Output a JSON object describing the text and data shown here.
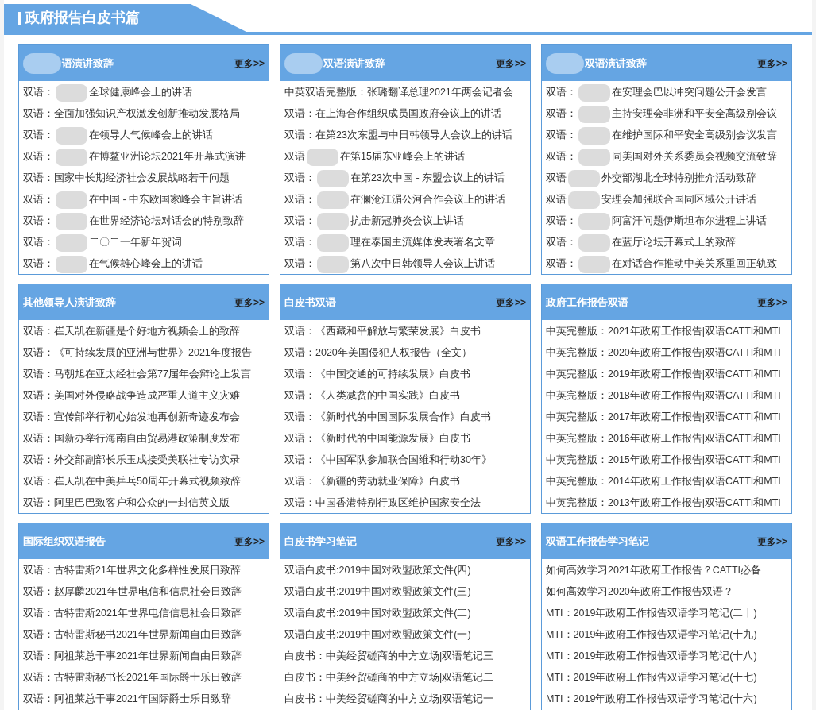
{
  "section_title": "政府报告白皮书篇",
  "panels": [
    {
      "title": "语演讲致辞",
      "title_blurred": true,
      "more": "更多>>",
      "items": [
        {
          "lead": "双语：",
          "tail": "全球健康峰会上的讲话",
          "blurred": true
        },
        {
          "lead": "双语：全面加强知识产权激发创新推动发展格局"
        },
        {
          "lead": "双语：",
          "tail": "在领导人气候峰会上的讲话",
          "blurred": true
        },
        {
          "lead": "双语：",
          "tail": "在博鳌亚洲论坛2021年开幕式演讲",
          "blurred": true
        },
        {
          "lead": "双语：国家中长期经济社会发展战略若干问题"
        },
        {
          "lead": "双语：",
          "tail": "在中国 - 中东欧国家峰会主旨讲话",
          "blurred": true
        },
        {
          "lead": "双语：",
          "tail": "在世界经济论坛对话会的特别致辞",
          "blurred": true
        },
        {
          "lead": "双语：",
          "tail": "二〇二一年新年贺词",
          "blurred": true
        },
        {
          "lead": "双语：",
          "tail": "在气候雄心峰会上的讲话",
          "blurred": true
        }
      ]
    },
    {
      "title": "双语演讲致辞",
      "title_blurred": true,
      "more": "更多>>",
      "items": [
        {
          "lead": "中英双语完整版：张璐翻译总理2021年两会记者会"
        },
        {
          "lead": "双语：在上海合作组织成员国政府会议上的讲话"
        },
        {
          "lead": "双语：在第23次东盟与中日韩领导人会议上的讲话"
        },
        {
          "lead": "双语",
          "tail": "在第15届东亚峰会上的讲话",
          "blurred": true
        },
        {
          "lead": "双语：",
          "tail": "在第23次中国 - 东盟会议上的讲话",
          "blurred": true
        },
        {
          "lead": "双语：",
          "tail": "在澜沧江湄公河合作会议上的讲话",
          "blurred": true
        },
        {
          "lead": "双语：",
          "tail": "抗击新冠肺炎会议上讲话",
          "blurred": true
        },
        {
          "lead": "双语：",
          "tail": "理在泰国主流媒体发表署名文章",
          "blurred": true
        },
        {
          "lead": "双语：",
          "tail": "第八次中日韩领导人会议上讲话",
          "blurred": true
        }
      ]
    },
    {
      "title": "双语演讲致辞",
      "title_blurred": true,
      "more": "更多>>",
      "items": [
        {
          "lead": "双语：",
          "tail": "在安理会巴以冲突问题公开会发言",
          "blurred": true
        },
        {
          "lead": "双语：",
          "tail": "主持安理会非洲和平安全高级别会议",
          "blurred": true
        },
        {
          "lead": "双语：",
          "tail": "在维护国际和平安全高级别会议发言",
          "blurred": true
        },
        {
          "lead": "双语：",
          "tail": "同美国对外关系委员会视频交流致辞",
          "blurred": true
        },
        {
          "lead": "双语",
          "tail": "外交部湖北全球特别推介活动致辞",
          "blurred": true
        },
        {
          "lead": "双语",
          "tail": "安理会加强联合国同区域公开讲话",
          "blurred": true
        },
        {
          "lead": "双语：",
          "tail": "阿富汗问题伊斯坦布尔进程上讲话",
          "blurred": true
        },
        {
          "lead": "双语：",
          "tail": "在蓝厅论坛开幕式上的致辞",
          "blurred": true
        },
        {
          "lead": "双语：",
          "tail": "在对话合作推动中美关系重回正轨致",
          "blurred": true
        }
      ]
    },
    {
      "title": "其他领导人演讲致辞",
      "more": "更多>>",
      "items": [
        {
          "lead": "双语：崔天凯在新疆是个好地方视频会上的致辞"
        },
        {
          "lead": "双语：《可持续发展的亚洲与世界》2021年度报告"
        },
        {
          "lead": "双语：马朝旭在亚太经社会第77届年会辩论上发言"
        },
        {
          "lead": "双语：美国对外侵略战争造成严重人道主义灾难"
        },
        {
          "lead": "双语：宣传部举行初心始发地再创新奇迹发布会"
        },
        {
          "lead": "双语：国新办举行海南自由贸易港政策制度发布"
        },
        {
          "lead": "双语：外交部副部长乐玉成接受美联社专访实录"
        },
        {
          "lead": "双语：崔天凯在中美乒乓50周年开幕式视频致辞"
        },
        {
          "lead": "双语：阿里巴巴致客户和公众的一封信英文版"
        }
      ]
    },
    {
      "title": "白皮书双语",
      "more": "更多>>",
      "items": [
        {
          "lead": "双语：《西藏和平解放与繁荣发展》白皮书"
        },
        {
          "lead": "双语：2020年美国侵犯人权报告（全文）"
        },
        {
          "lead": "双语：《中国交通的可持续发展》白皮书"
        },
        {
          "lead": "双语：《人类减贫的中国实践》白皮书"
        },
        {
          "lead": "双语：《新时代的中国国际发展合作》白皮书"
        },
        {
          "lead": "双语：《新时代的中国能源发展》白皮书"
        },
        {
          "lead": "双语：《中国军队参加联合国维和行动30年》"
        },
        {
          "lead": "双语：《新疆的劳动就业保障》白皮书"
        },
        {
          "lead": "双语：中国香港特别行政区维护国家安全法"
        }
      ]
    },
    {
      "title": "政府工作报告双语",
      "more": "更多>>",
      "items": [
        {
          "lead": "中英完整版：2021年政府工作报告|双语CATTI和MTI"
        },
        {
          "lead": "中英完整版：2020年政府工作报告|双语CATTI和MTI"
        },
        {
          "lead": "中英完整版：2019年政府工作报告|双语CATTI和MTI"
        },
        {
          "lead": "中英完整版：2018年政府工作报告|双语CATTI和MTI"
        },
        {
          "lead": "中英完整版：2017年政府工作报告|双语CATTI和MTI"
        },
        {
          "lead": "中英完整版：2016年政府工作报告|双语CATTI和MTI"
        },
        {
          "lead": "中英完整版：2015年政府工作报告|双语CATTI和MTI"
        },
        {
          "lead": "中英完整版：2014年政府工作报告|双语CATTI和MTI"
        },
        {
          "lead": "中英完整版：2013年政府工作报告|双语CATTI和MTI"
        }
      ]
    },
    {
      "title": "国际组织双语报告",
      "more": "更多>>",
      "items": [
        {
          "lead": "双语：古特雷斯21年世界文化多样性发展日致辞"
        },
        {
          "lead": "双语：赵厚麟2021年世界电信和信息社会日致辞"
        },
        {
          "lead": "双语：古特雷斯2021年世界电信信息社会日致辞"
        },
        {
          "lead": "双语：古特雷斯秘书2021年世界新闻自由日致辞"
        },
        {
          "lead": "双语：阿祖莱总干事2021年世界新闻自由日致辞"
        },
        {
          "lead": "双语：古特雷斯秘书长2021年国际爵士乐日致辞"
        },
        {
          "lead": "双语：阿祖莱总干事2021年国际爵士乐日致辞"
        }
      ]
    },
    {
      "title": "白皮书学习笔记",
      "more": "更多>>",
      "items": [
        {
          "lead": "双语白皮书:2019中国对欧盟政策文件(四)"
        },
        {
          "lead": "双语白皮书:2019中国对欧盟政策文件(三)"
        },
        {
          "lead": "双语白皮书:2019中国对欧盟政策文件(二)"
        },
        {
          "lead": "双语白皮书:2019中国对欧盟政策文件(一)"
        },
        {
          "lead": "白皮书：中美经贸磋商的中方立场|双语笔记三"
        },
        {
          "lead": "白皮书：中美经贸磋商的中方立场|双语笔记二"
        },
        {
          "lead": "白皮书：中美经贸磋商的中方立场|双语笔记一"
        }
      ]
    },
    {
      "title": "双语工作报告学习笔记",
      "more": "更多>>",
      "items": [
        {
          "lead": "如何高效学习2021年政府工作报告？CATTI必备"
        },
        {
          "lead": "如何高效学习2020年政府工作报告双语？"
        },
        {
          "lead": "MTI：2019年政府工作报告双语学习笔记(二十)"
        },
        {
          "lead": "MTI：2019年政府工作报告双语学习笔记(十九)"
        },
        {
          "lead": "MTI：2019年政府工作报告双语学习笔记(十八)"
        },
        {
          "lead": "MTI：2019年政府工作报告双语学习笔记(十七)"
        },
        {
          "lead": "MTI：2019年政府工作报告双语学习笔记(十六)"
        }
      ]
    }
  ]
}
